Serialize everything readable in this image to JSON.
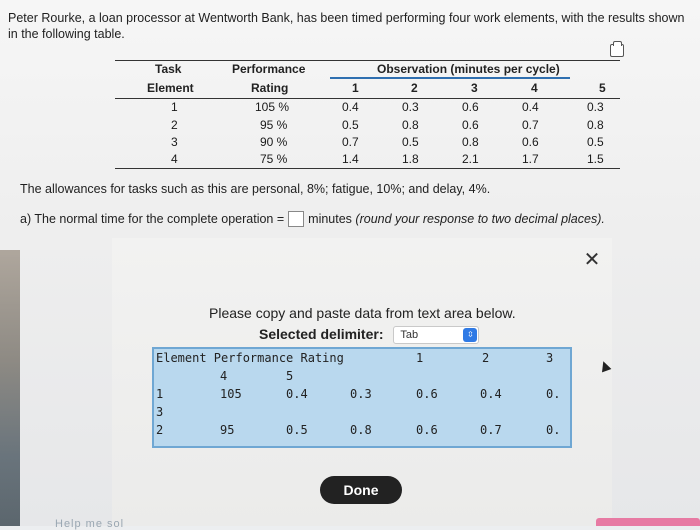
{
  "problem": {
    "intro": "Peter Rourke, a loan processor at Wentworth Bank, has been timed performing four work elements, with the results shown in the following table."
  },
  "table": {
    "headers": {
      "task_element": [
        "Task",
        "Element"
      ],
      "performance_rating": [
        "Performance",
        "Rating"
      ],
      "observation_group": "Observation (minutes per cycle)",
      "observation_numbers": [
        "1",
        "2",
        "3",
        "4",
        "5"
      ]
    },
    "rows": [
      {
        "element": "1",
        "rating": "105 %",
        "obs": [
          "0.4",
          "0.3",
          "0.6",
          "0.4",
          "0.3"
        ]
      },
      {
        "element": "2",
        "rating": "95 %",
        "obs": [
          "0.5",
          "0.8",
          "0.6",
          "0.7",
          "0.8"
        ]
      },
      {
        "element": "3",
        "rating": "90 %",
        "obs": [
          "0.7",
          "0.5",
          "0.8",
          "0.6",
          "0.5"
        ]
      },
      {
        "element": "4",
        "rating": "75 %",
        "obs": [
          "1.4",
          "1.8",
          "2.1",
          "1.7",
          "1.5"
        ]
      }
    ]
  },
  "allowances": "The allowances for tasks such as this are personal, 8%; fatigue, 10%; and delay, 4%.",
  "question": {
    "prefix": "a) The normal time for the complete operation =",
    "suffix": "minutes",
    "hint": "(round your response to two decimal places)."
  },
  "modal": {
    "instruction": "Please copy and paste data from text area below.",
    "delimiter_label": "Selected delimiter:",
    "delimiter_value": "Tab",
    "done_label": "Done",
    "textarea_lines": [
      [
        "Element Performance Rating",
        "1",
        "2",
        "3"
      ],
      [
        "4",
        "5"
      ],
      [
        "1",
        "105",
        "0.4",
        "0.3",
        "0.6",
        "0.4",
        "0."
      ],
      [
        "3"
      ],
      [
        "2",
        "95",
        "0.5",
        "0.8",
        "0.6",
        "0.7",
        "0."
      ]
    ]
  },
  "footer": {
    "help_text": "Help me sol"
  },
  "icons": {
    "copy": "copy-icon",
    "close": "close-icon",
    "select_arrow": "up-down-arrow-icon"
  },
  "colors": {
    "textarea_bg": "#b9d8ee",
    "select_arrow": "#2f7ae5",
    "done_bg": "#222222",
    "pink_bar": "#e77aa3"
  }
}
